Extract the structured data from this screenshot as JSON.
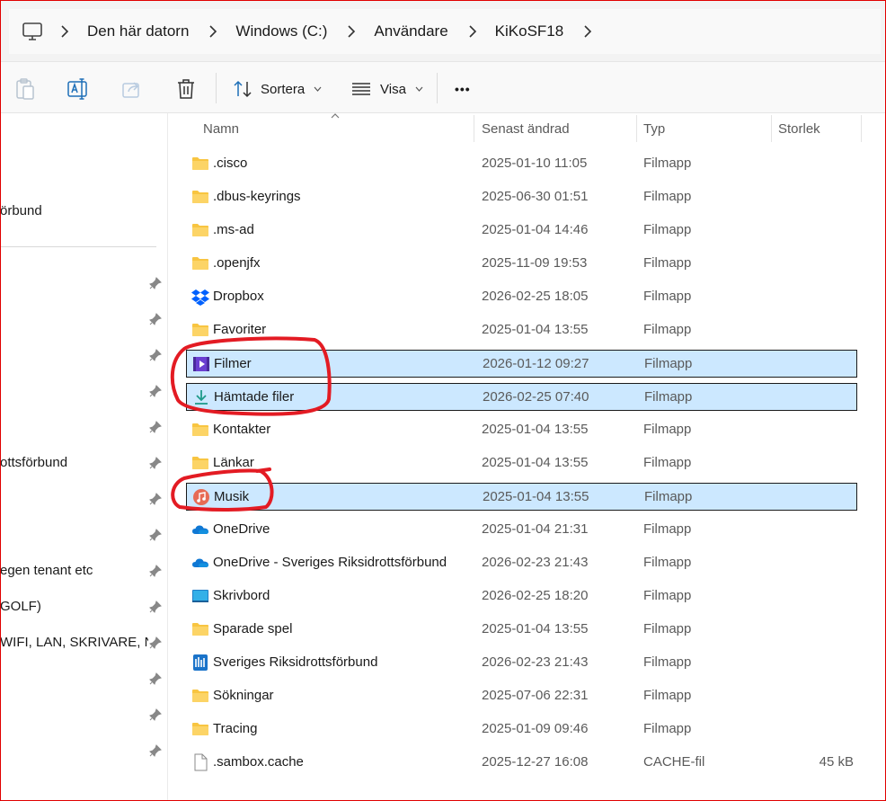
{
  "breadcrumb": {
    "items": [
      "Den här datorn",
      "Windows (C:)",
      "Användare",
      "KiKoSF18"
    ]
  },
  "toolbar": {
    "sort_label": "Sortera",
    "view_label": "Visa",
    "more_label": "•••"
  },
  "sidebar": {
    "items": [
      {
        "label": "örbund",
        "pinned": false
      },
      {
        "label": "",
        "pinned": true
      },
      {
        "label": "",
        "pinned": true
      },
      {
        "label": "",
        "pinned": true
      },
      {
        "label": "",
        "pinned": true
      },
      {
        "label": "",
        "pinned": true
      },
      {
        "label": "ottsförbund",
        "pinned": true
      },
      {
        "label": "",
        "pinned": true
      },
      {
        "label": "",
        "pinned": true
      },
      {
        "label": "egen tenant etc",
        "pinned": true
      },
      {
        "label": " GOLF)",
        "pinned": true
      },
      {
        "label": "WIFI, LAN, SKRIVARE, NA",
        "pinned": true
      },
      {
        "label": "",
        "pinned": true
      },
      {
        "label": "",
        "pinned": true
      },
      {
        "label": "",
        "pinned": true
      }
    ]
  },
  "columns": {
    "name": "Namn",
    "modified": "Senast ändrad",
    "type": "Typ",
    "size": "Storlek"
  },
  "files": [
    {
      "name": ".cisco",
      "modified": "2025-01-10 11:05",
      "type": "Filmapp",
      "size": "",
      "icon": "folder-icon",
      "selected": false
    },
    {
      "name": ".dbus-keyrings",
      "modified": "2025-06-30 01:51",
      "type": "Filmapp",
      "size": "",
      "icon": "folder-icon",
      "selected": false
    },
    {
      "name": ".ms-ad",
      "modified": "2025-01-04 14:46",
      "type": "Filmapp",
      "size": "",
      "icon": "folder-icon",
      "selected": false
    },
    {
      "name": ".openjfx",
      "modified": "2025-11-09 19:53",
      "type": "Filmapp",
      "size": "",
      "icon": "folder-icon",
      "selected": false
    },
    {
      "name": "Dropbox",
      "modified": "2026-02-25 18:05",
      "type": "Filmapp",
      "size": "",
      "icon": "dropbox-icon",
      "selected": false
    },
    {
      "name": "Favoriter",
      "modified": "2025-01-04 13:55",
      "type": "Filmapp",
      "size": "",
      "icon": "folder-icon",
      "selected": false
    },
    {
      "name": "Filmer",
      "modified": "2026-01-12 09:27",
      "type": "Filmapp",
      "size": "",
      "icon": "videos-folder-icon",
      "selected": true
    },
    {
      "name": "Hämtade filer",
      "modified": "2026-02-25 07:40",
      "type": "Filmapp",
      "size": "",
      "icon": "downloads-icon",
      "selected": true
    },
    {
      "name": "Kontakter",
      "modified": "2025-01-04 13:55",
      "type": "Filmapp",
      "size": "",
      "icon": "folder-icon",
      "selected": false
    },
    {
      "name": "Länkar",
      "modified": "2025-01-04 13:55",
      "type": "Filmapp",
      "size": "",
      "icon": "folder-icon",
      "selected": false
    },
    {
      "name": "Musik",
      "modified": "2025-01-04 13:55",
      "type": "Filmapp",
      "size": "",
      "icon": "music-folder-icon",
      "selected": true
    },
    {
      "name": "OneDrive",
      "modified": "2025-01-04 21:31",
      "type": "Filmapp",
      "size": "",
      "icon": "onedrive-icon",
      "selected": false
    },
    {
      "name": "OneDrive - Sveriges Riksidrottsförbund",
      "modified": "2026-02-23 21:43",
      "type": "Filmapp",
      "size": "",
      "icon": "onedrive-icon",
      "selected": false
    },
    {
      "name": "Skrivbord",
      "modified": "2026-02-25 18:20",
      "type": "Filmapp",
      "size": "",
      "icon": "desktop-icon",
      "selected": false
    },
    {
      "name": "Sparade spel",
      "modified": "2025-01-04 13:55",
      "type": "Filmapp",
      "size": "",
      "icon": "folder-icon",
      "selected": false
    },
    {
      "name": "Sveriges Riksidrottsförbund",
      "modified": "2026-02-23 21:43",
      "type": "Filmapp",
      "size": "",
      "icon": "sharepoint-library-icon",
      "selected": false
    },
    {
      "name": "Sökningar",
      "modified": "2025-07-06 22:31",
      "type": "Filmapp",
      "size": "",
      "icon": "folder-icon",
      "selected": false
    },
    {
      "name": "Tracing",
      "modified": "2025-01-09 09:46",
      "type": "Filmapp",
      "size": "",
      "icon": "folder-icon",
      "selected": false
    },
    {
      "name": ".sambox.cache",
      "modified": "2025-12-27 16:08",
      "type": "CACHE-fil",
      "size": "45 kB",
      "icon": "file-icon",
      "selected": false
    }
  ],
  "colors": {
    "selection_bg": "#cce8ff",
    "folder_yellow": "#f8c541",
    "annotation_red": "#e31b23",
    "accent_blue": "#0067c0"
  }
}
